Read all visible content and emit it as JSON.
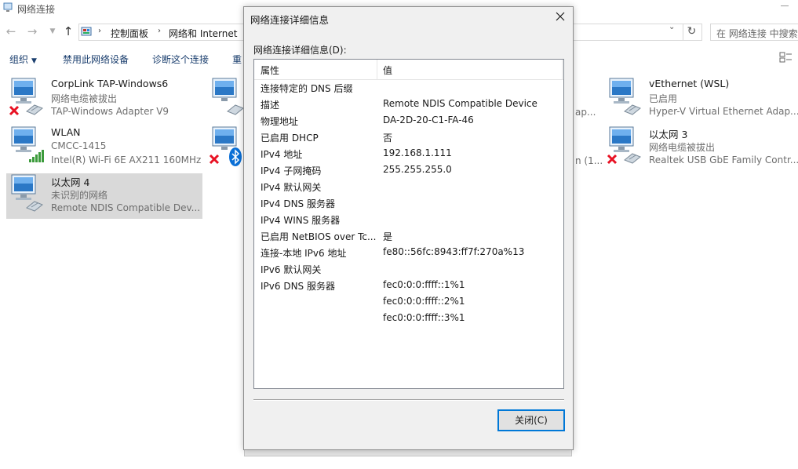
{
  "window": {
    "title": "网络连接"
  },
  "address": {
    "crumbs": [
      "控制面板",
      "网络和 Internet"
    ],
    "search_placeholder": "在 网络连接 中搜索"
  },
  "toolbar": {
    "organize": "组织",
    "disable": "禁用此网络设备",
    "diagnose": "诊断这个连接",
    "rename_partial": "重"
  },
  "items": [
    {
      "name": "CorpLink TAP-Windows6",
      "status": "网络电缆被拔出",
      "device": "TAP-Windows Adapter V9"
    },
    {
      "name": "WLAN",
      "status": "CMCC-1415",
      "device": "Intel(R) Wi-Fi 6E AX211 160MHz"
    },
    {
      "name": "以太网 4",
      "status": "未识别的网络",
      "device": "Remote NDIS Compatible Dev..."
    },
    {
      "name": "vEthernet (WSL)",
      "status": "已启用",
      "device": "Hyper-V Virtual Ethernet Adap..."
    },
    {
      "name": "以太网 3",
      "status": "网络电缆被拔出",
      "device": "Realtek USB GbE Family Contr..."
    }
  ],
  "partial_texts": [
    "ap...",
    "n (1..."
  ],
  "dialog": {
    "title": "网络连接详细信息",
    "list_label": "网络连接详细信息(D):",
    "columns": [
      "属性",
      "值"
    ],
    "rows": [
      {
        "property": "连接特定的 DNS 后缀",
        "value": ""
      },
      {
        "property": "描述",
        "value": "Remote NDIS Compatible Device"
      },
      {
        "property": "物理地址",
        "value": "DA-2D-20-C1-FA-46"
      },
      {
        "property": "已启用 DHCP",
        "value": "否"
      },
      {
        "property": "IPv4 地址",
        "value": "192.168.1.111"
      },
      {
        "property": "IPv4 子网掩码",
        "value": "255.255.255.0"
      },
      {
        "property": "IPv4 默认网关",
        "value": ""
      },
      {
        "property": "IPv4 DNS 服务器",
        "value": ""
      },
      {
        "property": "IPv4 WINS 服务器",
        "value": ""
      },
      {
        "property": "已启用 NetBIOS over Tc...",
        "value": "是"
      },
      {
        "property": "连接-本地 IPv6 地址",
        "value": "fe80::56fc:8943:ff7f:270a%13"
      },
      {
        "property": "IPv6 默认网关",
        "value": ""
      },
      {
        "property": "IPv6 DNS 服务器",
        "value": "fec0:0:0:ffff::1%1"
      },
      {
        "property": "",
        "value": "fec0:0:0:ffff::2%1"
      },
      {
        "property": "",
        "value": "fec0:0:0:ffff::3%1"
      }
    ],
    "close_label": "关闭(C)"
  },
  "colors": {
    "accent": "#0078d7",
    "selection": "#d9d9d9",
    "dialog_bg": "#f0f0f0",
    "error_red": "#e81123",
    "signal_green": "#3c9b3c",
    "bluetooth_blue": "#0a6fd6"
  },
  "icons": [
    "control-panel-icon",
    "network-adapter-icon",
    "error-x-icon",
    "wifi-signal-icon",
    "bluetooth-icon",
    "close-icon",
    "view-options-icon"
  ]
}
